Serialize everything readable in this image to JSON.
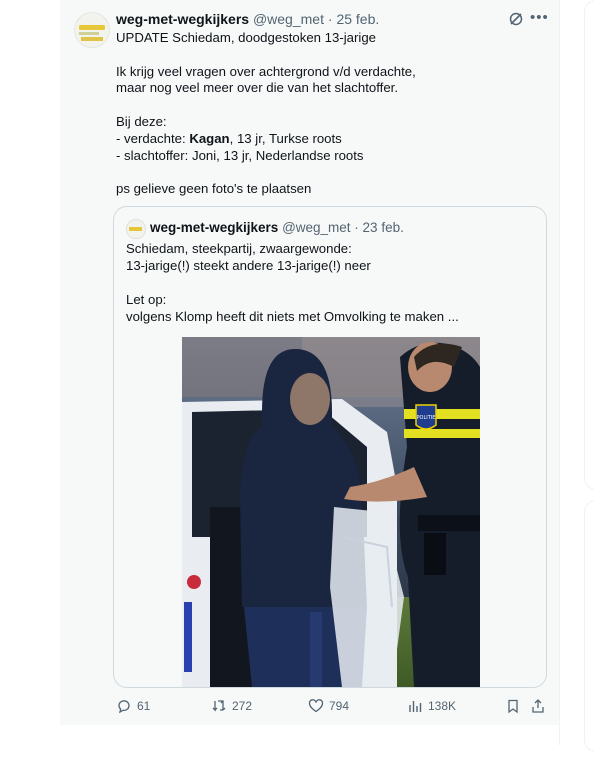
{
  "tweet": {
    "author_name": "weg-met-wegkijkers",
    "handle": "@weg_met",
    "separator": " · ",
    "date": "25 feb.",
    "lines": [
      "UPDATE Schiedam, doodgestoken 13-jarige",
      "",
      "Ik krijg veel vragen over achtergrond v/d verdachte,",
      "maar nog veel meer over die van het slachtoffer.",
      "",
      "Bij deze:"
    ],
    "suspect_prefix": "- verdachte: ",
    "suspect_name": "Kagan",
    "suspect_suffix": ", 13 jr, Turkse roots",
    "victim_line": "- slachtoffer: Joni, 13 jr, Nederlandse roots",
    "ps_line": "ps  gelieve geen foto's te plaatsen"
  },
  "quoted": {
    "author_name": "weg-met-wegkijkers",
    "handle": "@weg_met",
    "separator": " · ",
    "date": "23 feb.",
    "text": "Schiedam, steekpartij, zwaargewonde:\n13-jarige(!) steekt andere 13-jarige(!) neer\n\nLet op:\nvolgens Klomp heeft dit niets met Omvolking te maken  ...",
    "photo_badge": "POLITIE"
  },
  "actions": {
    "replies": "61",
    "reposts": "272",
    "likes": "794",
    "views": "138K"
  },
  "icons": [
    "grok-icon",
    "more-icon",
    "reply-icon",
    "repost-icon",
    "like-icon",
    "views-icon",
    "bookmark-icon",
    "share-icon"
  ],
  "colors": {
    "muted": "#536471",
    "border": "#cfd9de",
    "police_yellow": "#e3e022",
    "police_blue": "#1e3d8f"
  }
}
